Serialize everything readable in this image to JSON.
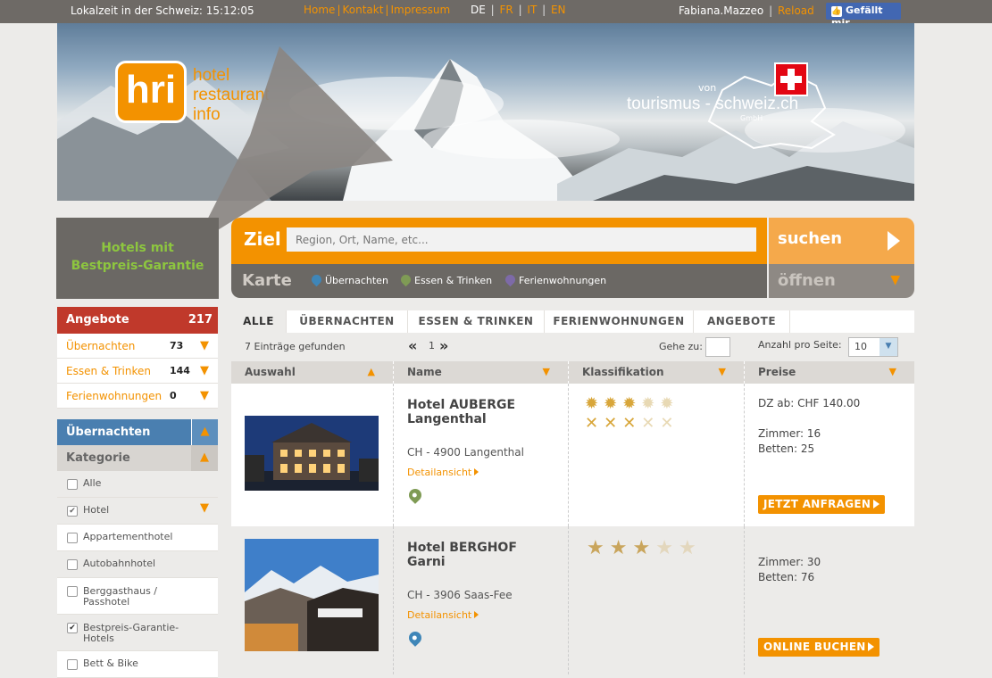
{
  "topbar": {
    "local_time": "Lokalzeit in der Schweiz: 15:12:05",
    "nav": [
      "Home",
      "Kontakt",
      "Impressum"
    ],
    "languages": {
      "active": "DE",
      "others": [
        "FR",
        "IT",
        "EN"
      ]
    },
    "user": "Fabiana.Mazzeo",
    "reload": "Reload",
    "facebook": "Gefällt mir"
  },
  "banner": {
    "logo_mark": "hri",
    "logo_lines": [
      "hotel",
      "restaurant",
      "info"
    ],
    "partner_von": "von",
    "partner_name": "tourismus - schweiz.ch",
    "partner_gmbh": "GmbH"
  },
  "promo": {
    "line1": "Hotels mit",
    "line2": "Bestpreis-Garantie"
  },
  "search": {
    "label": "Ziel",
    "placeholder": "Region, Ort, Name, etc...",
    "submit": "suchen",
    "map_label": "Karte",
    "map_links": [
      "Übernachten",
      "Essen & Trinken",
      "Ferienwohnungen"
    ],
    "open": "öffnen"
  },
  "sidebar": {
    "offers_title": "Angebote",
    "offers_count": "217",
    "offers": [
      {
        "label": "Übernachten",
        "count": "73"
      },
      {
        "label": "Essen & Trinken",
        "count": "144"
      },
      {
        "label": "Ferienwohnungen",
        "count": "0"
      }
    ],
    "section_title": "Übernachten",
    "category_title": "Kategorie",
    "categories": [
      {
        "label": "Alle",
        "checked": false
      },
      {
        "label": "Hotel",
        "checked": true
      },
      {
        "label": "Appartementhotel",
        "checked": false
      },
      {
        "label": "Autobahnhotel",
        "checked": false
      },
      {
        "label": "Berggasthaus / Passhotel",
        "checked": false
      },
      {
        "label": "Bestpreis-Garantie-Hotels",
        "checked": true
      },
      {
        "label": "Bett & Bike",
        "checked": false
      }
    ]
  },
  "tabs": [
    "ALLE",
    "ÜBERNACHTEN",
    "ESSEN & TRINKEN",
    "FERIENWOHNUNGEN",
    "ANGEBOTE"
  ],
  "results": {
    "found": "7 Einträge gefunden",
    "page": "1",
    "goto_label": "Gehe zu:",
    "per_page_label": "Anzahl pro Seite:",
    "per_page_value": "10"
  },
  "columns": [
    "Auswahl",
    "Name",
    "Klassifikation",
    "Preise"
  ],
  "hotels": [
    {
      "name_line1": "Hotel AUBERGE",
      "name_line2": "Langenthal",
      "location": "CH - 4900 Langenthal",
      "detail": "Detailansicht",
      "rating_type": "sun",
      "stars": 3,
      "max_stars": 5,
      "price_line": "DZ ab: CHF 140.00",
      "rooms": "Zimmer: 16",
      "beds": "Betten: 25",
      "cta": "JETZT ANFRAGEN",
      "pin_color": "#7f9b55"
    },
    {
      "name_line1": "Hotel BERGHOF",
      "name_line2": "Garni",
      "location": "CH - 3906 Saas-Fee",
      "detail": "Detailansicht",
      "rating_type": "star",
      "stars": 3,
      "max_stars": 5,
      "price_line": "",
      "rooms": "Zimmer: 30",
      "beds": "Betten: 76",
      "cta": "ONLINE BUCHEN",
      "pin_color": "#3f86b8"
    }
  ],
  "colors": {
    "accent": "#f39200",
    "offers": "#c0392b",
    "section": "#4a7fb0",
    "promo_text": "#8dc63f"
  }
}
